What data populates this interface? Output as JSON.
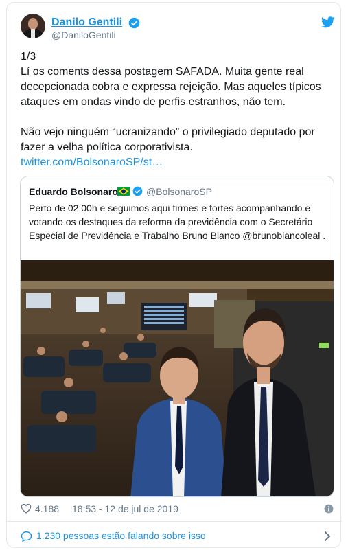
{
  "author": {
    "name": "Danilo Gentili",
    "handle": "@DaniloGentili"
  },
  "tweet": {
    "lines_a": [
      "1/3",
      "Lí os coments dessa postagem SAFADA. Muita gente real decepcionada cobra e expressa rejeição. Mas aqueles típicos ataques em ondas vindo de perfis estranhos, não tem."
    ],
    "line_b": "Não vejo ninguém “ucranizando” o privilegiado deputado por fazer a velha política corporativista.",
    "link": "twitter.com/BolsonaroSP/st…"
  },
  "quoted": {
    "name": "Eduardo Bolsonaro",
    "handle": "@BolsonaroSP",
    "text": "Perto de 02:00h e seguimos aqui firmes e fortes acompanhando e votando os destaques da reforma da previdência com o Secretário Especial de Previdência e Trabalho Bruno Bianco  @brunobiancoleal .",
    "photo_icon": "photo-two-men-in-chamber"
  },
  "footer": {
    "likes": "4.188",
    "timestamp": "18:53 - 12 de jul de 2019",
    "conversation": "1.230 pessoas estão falando sobre isso"
  },
  "colors": {
    "link": "#1b95e0",
    "muted": "#657786",
    "border": "#e1e8ed"
  }
}
